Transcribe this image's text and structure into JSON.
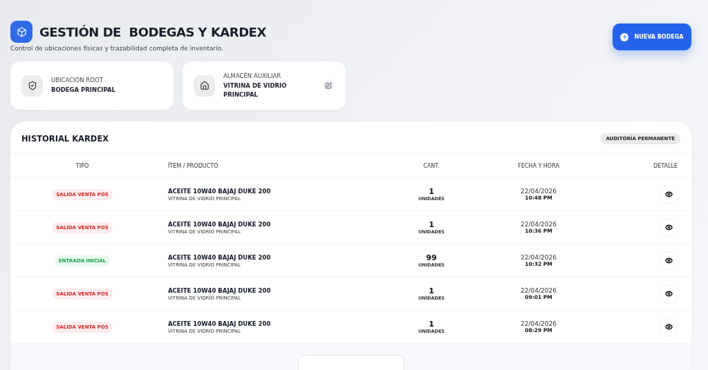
{
  "header": {
    "title": "GESTIÓN DE  BODEGAS Y KARDEX",
    "subtitle": "Control de ubicaciones físicas y trazabilidad completa de inventario.",
    "new_button": "NUEVA BODEGA"
  },
  "locations": [
    {
      "kind": "root",
      "label": "UBICACIÓN ROOT",
      "name": "BODEGA PRINCIPAL",
      "editable": false
    },
    {
      "kind": "auxiliar",
      "label": "ALMACÉN AUXILIAR",
      "name": "VITRINA DE VIDRIO PRINCIPAL",
      "editable": true
    }
  ],
  "kardex": {
    "title": "HISTORIAL KARDEX",
    "badge": "AUDITORÍA PERMANENTE",
    "columns": [
      "TIPO",
      "ÍTEM / PRODUCTO",
      "CANT.",
      "FECHA Y HORA",
      "DETALLE"
    ],
    "rows": [
      {
        "type": "SALIDA VENTA POS",
        "kind": "out",
        "item": "ACEITE 10W40 BAJAJ DUKE 200",
        "location": "VITRINA DE VIDRIO PRINCIPAL",
        "qty": "1",
        "unit": "UNIDADES",
        "date": "22/04/2026",
        "time": "10:48 PM"
      },
      {
        "type": "SALIDA VENTA POS",
        "kind": "out",
        "item": "ACEITE 10W40 BAJAJ DUKE 200",
        "location": "VITRINA DE VIDRIO PRINCIPAL",
        "qty": "1",
        "unit": "UNIDADES",
        "date": "22/04/2026",
        "time": "10:36 PM"
      },
      {
        "type": "ENTRADA INICIAL",
        "kind": "in",
        "item": "ACEITE 10W40 BAJAJ DUKE 200",
        "location": "VITRINA DE VIDRIO PRINCIPAL",
        "qty": "99",
        "unit": "UNIDADES",
        "date": "22/04/2026",
        "time": "10:32 PM"
      },
      {
        "type": "SALIDA VENTA POS",
        "kind": "out",
        "item": "ACEITE 10W40 BAJAJ DUKE 200",
        "location": "VITRINA DE VIDRIO PRINCIPAL",
        "qty": "1",
        "unit": "UNIDADES",
        "date": "22/04/2026",
        "time": "09:01 PM"
      },
      {
        "type": "SALIDA VENTA POS",
        "kind": "out",
        "item": "ACEITE 10W40 BAJAJ DUKE 200",
        "location": "VITRINA DE VIDRIO PRINCIPAL",
        "qty": "1",
        "unit": "UNIDADES",
        "date": "22/04/2026",
        "time": "08:29 PM"
      }
    ]
  }
}
